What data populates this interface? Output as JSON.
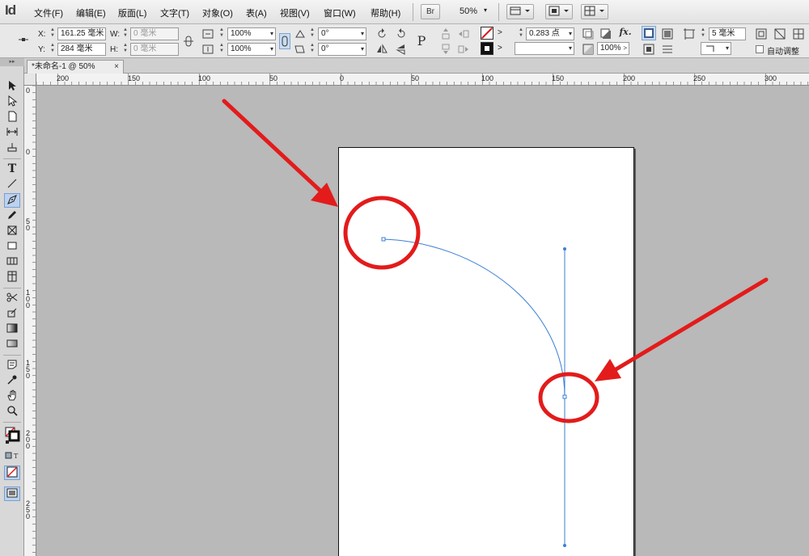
{
  "app": {
    "logo": "Id"
  },
  "menu": [
    "文件(F)",
    "编辑(E)",
    "版面(L)",
    "文字(T)",
    "对象(O)",
    "表(A)",
    "视图(V)",
    "窗口(W)",
    "帮助(H)"
  ],
  "menubar": {
    "bridge_label": "Br",
    "zoom": "50%",
    "zoom_caret": "▾"
  },
  "control": {
    "x_label": "X:",
    "x_value": "161.25 毫米",
    "y_label": "Y:",
    "y_value": "284 毫米",
    "w_label": "W:",
    "w_value": "0 毫米",
    "h_label": "H:",
    "h_value": "0 毫米",
    "scale_x": "100%",
    "scale_y": "100%",
    "rotate": "0°",
    "shear": "0°",
    "stroke_weight": "0.283 点",
    "opacity": "100%",
    "offset": "5 毫米",
    "auto_fit_label": "自动调整"
  },
  "tab": {
    "title": "*未命名-1 @ 50%",
    "close": "×"
  },
  "ruler": {
    "h_ticks": [
      "200",
      "150",
      "100",
      "50",
      "0",
      "50",
      "100",
      "150",
      "200",
      "250",
      "300"
    ],
    "v_ticks": [
      "0",
      "0",
      "50",
      "100",
      "150",
      "200",
      "250"
    ]
  },
  "colors": {
    "accent_red": "#e31b1b",
    "path_blue": "#3a7fd5",
    "pasteboard": "#b9b9b9"
  },
  "icons": [
    "pen-tool-icon",
    "selection-tool-icon",
    "direct-selection-tool-icon",
    "type-tool-icon",
    "hand-tool-icon",
    "zoom-tool-icon"
  ]
}
